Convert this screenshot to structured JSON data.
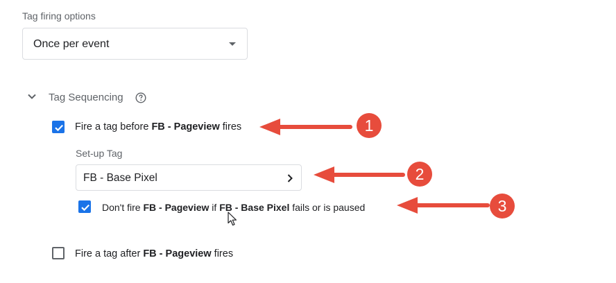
{
  "firing": {
    "label": "Tag firing options",
    "value": "Once per event"
  },
  "sequencing": {
    "title": "Tag Sequencing",
    "before": {
      "checked": true,
      "prefix": "Fire a tag before",
      "tag": "FB - Pageview",
      "suffix": "fires"
    },
    "setup": {
      "label": "Set-up Tag",
      "value": "FB - Base Pixel"
    },
    "dontfire": {
      "checked": true,
      "text1": "Don't fire",
      "tag1": "FB - Pageview",
      "text2": "if",
      "tag2": "FB - Base Pixel",
      "text3": "fails or is paused"
    },
    "after": {
      "checked": false,
      "prefix": "Fire a tag after",
      "tag": "FB - Pageview",
      "suffix": "fires"
    }
  },
  "annotations": {
    "badges": [
      "1",
      "2",
      "3"
    ],
    "color": "#e74c3c"
  },
  "colors": {
    "accent": "#1a73e8",
    "border": "#dadce0",
    "muted": "#5f6368"
  },
  "icons": [
    "chevron-down-icon",
    "help-circle-icon",
    "check-icon",
    "chevron-right-icon",
    "arrow-left-icon",
    "mouse-cursor-icon"
  ]
}
